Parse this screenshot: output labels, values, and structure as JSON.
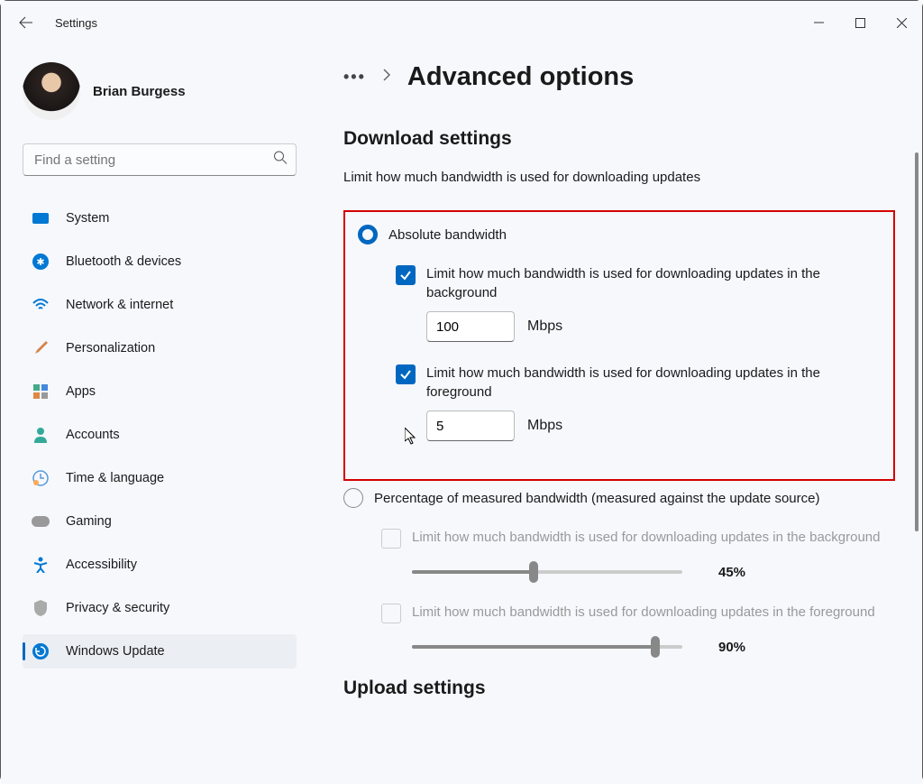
{
  "title": "Settings",
  "user": {
    "name": "Brian Burgess"
  },
  "search": {
    "placeholder": "Find a setting"
  },
  "sidebar": {
    "items": [
      {
        "label": "System"
      },
      {
        "label": "Bluetooth & devices"
      },
      {
        "label": "Network & internet"
      },
      {
        "label": "Personalization"
      },
      {
        "label": "Apps"
      },
      {
        "label": "Accounts"
      },
      {
        "label": "Time & language"
      },
      {
        "label": "Gaming"
      },
      {
        "label": "Accessibility"
      },
      {
        "label": "Privacy & security"
      },
      {
        "label": "Windows Update"
      }
    ]
  },
  "page": {
    "title": "Advanced options",
    "section1_title": "Download settings",
    "section1_desc": "Limit how much bandwidth is used for downloading updates",
    "radio_absolute": "Absolute bandwidth",
    "check_bg": "Limit how much bandwidth is used for downloading updates in the background",
    "bg_value": "100",
    "bg_unit": "Mbps",
    "check_fg": "Limit how much bandwidth is used for downloading updates in the foreground",
    "fg_value": "5",
    "fg_unit": "Mbps",
    "radio_percent": "Percentage of measured bandwidth (measured against the update source)",
    "check_bg2": "Limit how much bandwidth is used for downloading updates in the background",
    "slider1_val": "45%",
    "slider1_pct": 45,
    "check_fg2": "Limit how much bandwidth is used for downloading updates in the foreground",
    "slider2_val": "90%",
    "slider2_pct": 90,
    "section2_title": "Upload settings"
  }
}
